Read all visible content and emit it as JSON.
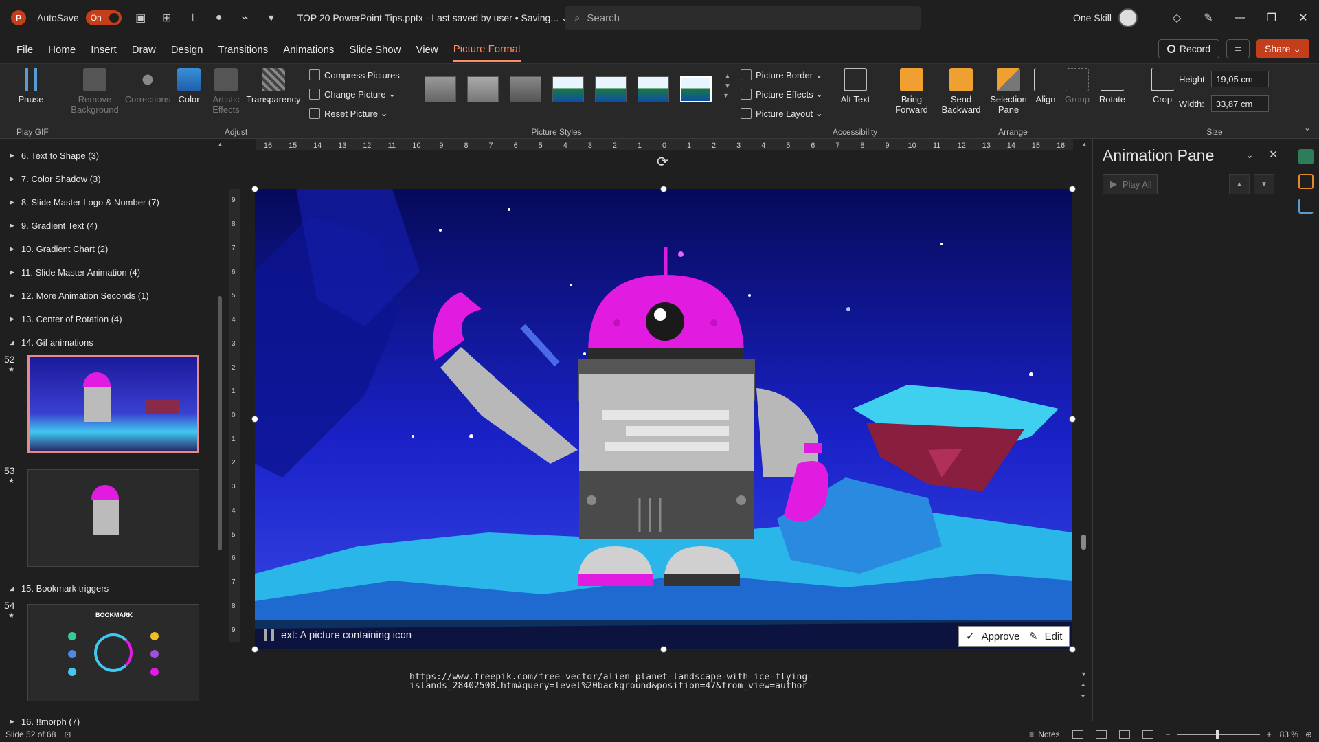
{
  "titlebar": {
    "autosave_label": "AutoSave",
    "autosave_state": "On",
    "document_title": "TOP 20 PowerPoint Tips.pptx  -  Last saved by user  •  Saving... ⌄",
    "search_placeholder": "Search",
    "user_name": "One Skill"
  },
  "menu": {
    "tabs": [
      "File",
      "Home",
      "Insert",
      "Draw",
      "Design",
      "Transitions",
      "Animations",
      "Slide Show",
      "View",
      "Picture Format"
    ],
    "active_tab": "Picture Format",
    "record_label": "Record",
    "share_label": "Share"
  },
  "ribbon": {
    "play_gif": {
      "pause_label": "Pause",
      "group_label": "Play GIF"
    },
    "adjust": {
      "remove_background": "Remove Background",
      "corrections": "Corrections",
      "color": "Color",
      "artistic_effects": "Artistic Effects",
      "transparency": "Transparency",
      "compress_pictures": "Compress Pictures",
      "change_picture": "Change Picture",
      "reset_picture": "Reset Picture",
      "group_label": "Adjust"
    },
    "picture_styles": {
      "picture_border": "Picture Border",
      "picture_effects": "Picture Effects",
      "picture_layout": "Picture Layout",
      "group_label": "Picture Styles"
    },
    "accessibility": {
      "alt_text": "Alt Text",
      "group_label": "Accessibility"
    },
    "arrange": {
      "bring_forward": "Bring Forward",
      "send_backward": "Send Backward",
      "selection_pane": "Selection Pane",
      "align": "Align",
      "group": "Group",
      "rotate": "Rotate",
      "group_label": "Arrange"
    },
    "size": {
      "crop": "Crop",
      "height_label": "Height:",
      "height_value": "19,05 cm",
      "width_label": "Width:",
      "width_value": "33,87 cm",
      "group_label": "Size"
    }
  },
  "sidepanel": {
    "sections": [
      "6. Text to Shape (3)",
      "7. Color Shadow (3)",
      "8. Slide Master Logo & Number (7)",
      "9. Gradient Text (4)",
      "10. Gradient Chart (2)",
      "11. Slide Master Animation (4)",
      "12. More Animation Seconds (1)",
      "13. Center of Rotation (4)",
      "14. Gif animations",
      "15. Bookmark triggers",
      "16. !!morph (7)"
    ],
    "slide_numbers": [
      "52",
      "53",
      "54"
    ],
    "bookmark_thumb_title": "BOOKMARK"
  },
  "canvas": {
    "alt_text": "ext: A picture containing icon",
    "approve_label": "Approve",
    "edit_label": "Edit",
    "source_url_line1": "https://www.freepik.com/free-vector/alien-planet-landscape-with-ice-flying-",
    "source_url_line2": "islands_28402508.htm#query=level%20background&position=47&from_view=author",
    "ruler_h_ticks": [
      "16",
      "15",
      "14",
      "13",
      "12",
      "11",
      "10",
      "9",
      "8",
      "7",
      "6",
      "5",
      "4",
      "3",
      "2",
      "1",
      "0",
      "1",
      "2",
      "3",
      "4",
      "5",
      "6",
      "7",
      "8",
      "9",
      "10",
      "11",
      "12",
      "13",
      "14",
      "15",
      "16"
    ],
    "ruler_v_ticks": [
      "9",
      "8",
      "7",
      "6",
      "5",
      "4",
      "3",
      "2",
      "1",
      "0",
      "1",
      "2",
      "3",
      "4",
      "5",
      "6",
      "7",
      "8",
      "9"
    ]
  },
  "animpane": {
    "title": "Animation Pane",
    "play_all_label": "Play All"
  },
  "statusbar": {
    "slide_info": "Slide 52 of 68",
    "notes_label": "Notes",
    "zoom_level": "83 %"
  },
  "colors": {
    "accent": "#c43e1c",
    "active_tab": "#ff8e66",
    "robot_magenta": "#e21be0",
    "sky_deep": "#0a0f7a",
    "ice": "#3fd0f0"
  }
}
